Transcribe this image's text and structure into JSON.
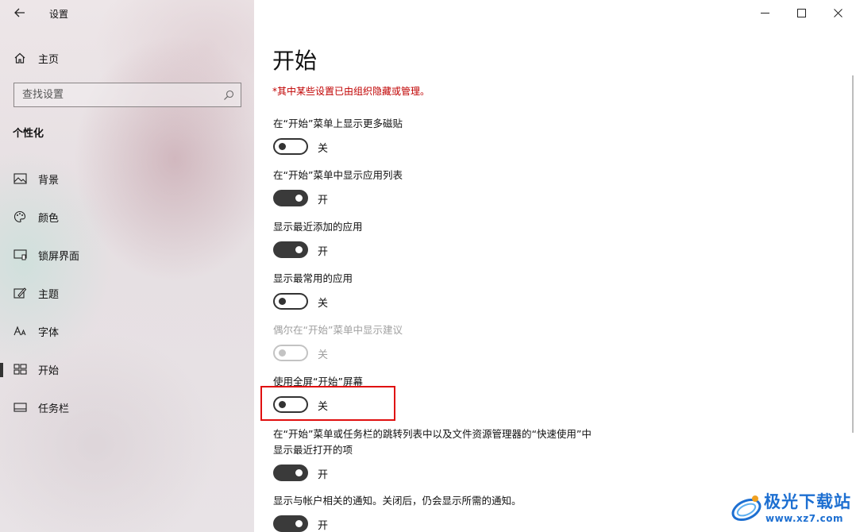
{
  "window": {
    "title": "设置"
  },
  "sidebar": {
    "home_label": "主页",
    "search_placeholder": "查找设置",
    "section_title": "个性化",
    "items": [
      {
        "label": "背景",
        "icon": "picture-icon"
      },
      {
        "label": "颜色",
        "icon": "palette-icon"
      },
      {
        "label": "锁屏界面",
        "icon": "lock-screen-icon"
      },
      {
        "label": "主题",
        "icon": "brush-icon"
      },
      {
        "label": "字体",
        "icon": "font-icon"
      },
      {
        "label": "开始",
        "icon": "start-icon",
        "active": true
      },
      {
        "label": "任务栏",
        "icon": "taskbar-icon"
      }
    ]
  },
  "main": {
    "title": "开始",
    "warning": "*其中某些设置已由组织隐藏或管理。",
    "settings": [
      {
        "title": "在“开始”菜单上显示更多磁贴",
        "state": "关",
        "on": false,
        "disabled": false
      },
      {
        "title": "在“开始”菜单中显示应用列表",
        "state": "开",
        "on": true,
        "disabled": false
      },
      {
        "title": "显示最近添加的应用",
        "state": "开",
        "on": true,
        "disabled": false
      },
      {
        "title": "显示最常用的应用",
        "state": "关",
        "on": false,
        "disabled": false
      },
      {
        "title": "偶尔在“开始”菜单中显示建议",
        "state": "关",
        "on": false,
        "disabled": true
      },
      {
        "title": "使用全屏“开始”屏幕",
        "state": "关",
        "on": false,
        "disabled": false
      },
      {
        "title": "在“开始”菜单或任务栏的跳转列表中以及文件资源管理器的“快速使用”中",
        "title_line2": "显示最近打开的项",
        "state": "开",
        "on": true,
        "disabled": false
      },
      {
        "title": "显示与帐户相关的通知。关闭后，仍会显示所需的通知。",
        "state": "开",
        "on": true,
        "disabled": false
      }
    ]
  },
  "watermark": {
    "name": "极光下载站",
    "url": "www.xz7.com"
  },
  "colors": {
    "warning": "#c00000",
    "highlight": "#e01010",
    "watermark": "#1d6fd1"
  }
}
